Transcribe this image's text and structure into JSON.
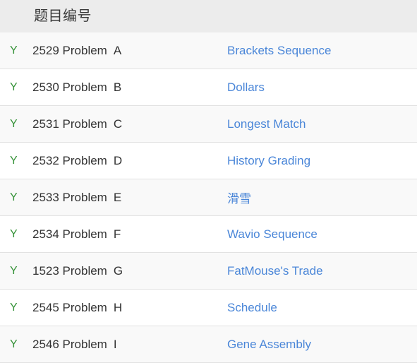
{
  "table": {
    "header": {
      "flag_column_label": "",
      "id_column_label": "题目编号",
      "title_column_label": ""
    },
    "colors": {
      "header_background": "#ececec",
      "row_background": "#ffffff",
      "row_alt_background": "#f9f9f9",
      "row_border": "#e2e2e2",
      "solved_flag": "#37933a",
      "link": "#4a86d8",
      "text": "#333333"
    },
    "rows": [
      {
        "flag": "Y",
        "id": "2529 Problem",
        "letter": "A",
        "title": "Brackets Sequence"
      },
      {
        "flag": "Y",
        "id": "2530 Problem",
        "letter": "B",
        "title": "Dollars"
      },
      {
        "flag": "Y",
        "id": "2531 Problem",
        "letter": "C",
        "title": "Longest Match"
      },
      {
        "flag": "Y",
        "id": "2532 Problem",
        "letter": "D",
        "title": "History Grading"
      },
      {
        "flag": "Y",
        "id": "2533 Problem",
        "letter": "E",
        "title": "滑雪"
      },
      {
        "flag": "Y",
        "id": "2534 Problem",
        "letter": "F",
        "title": "Wavio Sequence"
      },
      {
        "flag": "Y",
        "id": "1523 Problem",
        "letter": "G",
        "title": "FatMouse's Trade"
      },
      {
        "flag": "Y",
        "id": "2545 Problem",
        "letter": "H",
        "title": "Schedule"
      },
      {
        "flag": "Y",
        "id": "2546 Problem",
        "letter": "I",
        "title": "Gene Assembly"
      }
    ]
  }
}
